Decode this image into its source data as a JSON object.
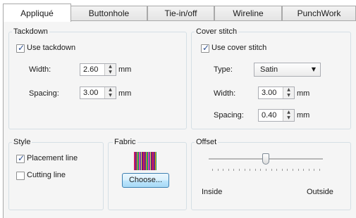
{
  "tabs": [
    "Appliqué",
    "Buttonhole",
    "Tie-in/off",
    "Wireline",
    "PunchWork"
  ],
  "tackdown": {
    "title": "Tackdown",
    "use_label": "Use tackdown",
    "width_label": "Width:",
    "width_value": "2.60",
    "spacing_label": "Spacing:",
    "spacing_value": "3.00",
    "unit": "mm"
  },
  "cover_stitch": {
    "title": "Cover stitch",
    "use_label": "Use cover stitch",
    "type_label": "Type:",
    "type_value": "Satin",
    "width_label": "Width:",
    "width_value": "3.00",
    "spacing_label": "Spacing:",
    "spacing_value": "0.40",
    "unit": "mm"
  },
  "style": {
    "title": "Style",
    "placement_label": "Placement line",
    "placement_checked": true,
    "cutting_label": "Cutting line",
    "cutting_checked": false
  },
  "fabric": {
    "title": "Fabric",
    "choose_label": "Choose..."
  },
  "offset": {
    "title": "Offset",
    "left_label": "Inside",
    "right_label": "Outside",
    "level": 0.5
  }
}
